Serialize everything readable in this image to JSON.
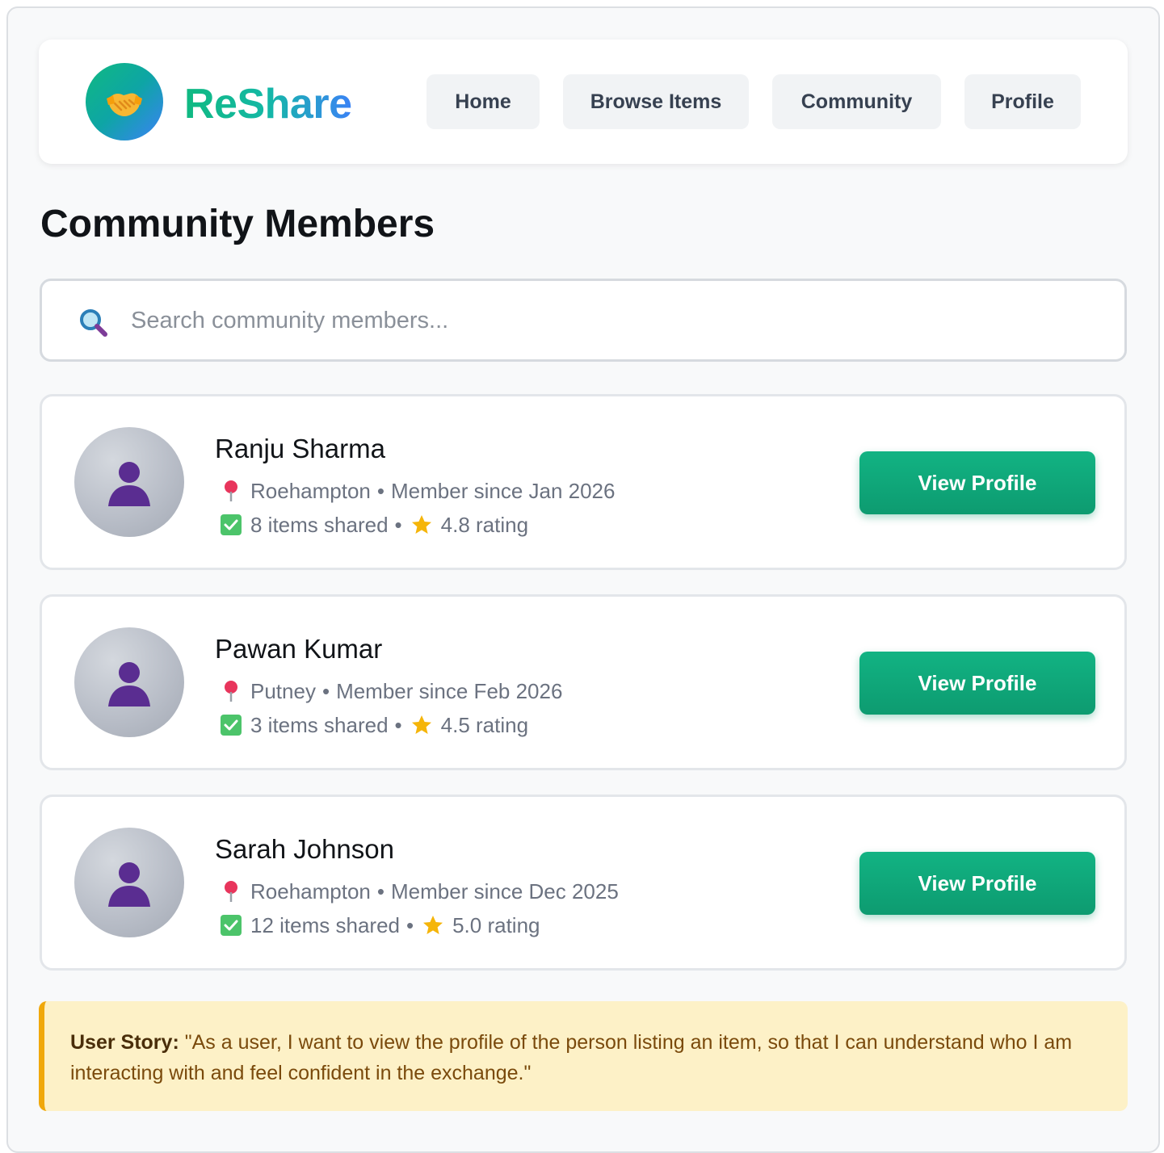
{
  "app": {
    "name": "ReShare"
  },
  "nav": {
    "items": [
      {
        "label": "Home"
      },
      {
        "label": "Browse Items"
      },
      {
        "label": "Community"
      },
      {
        "label": "Profile"
      }
    ]
  },
  "page": {
    "title": "Community Members"
  },
  "search": {
    "placeholder": "Search community members..."
  },
  "members": [
    {
      "name": "Ranju Sharma",
      "location": "Roehampton",
      "since": "Member since Jan 2026",
      "shared": "8 items shared",
      "rating": "4.8 rating",
      "button": "View Profile"
    },
    {
      "name": "Pawan Kumar",
      "location": "Putney",
      "since": "Member since Feb 2026",
      "shared": "3 items shared",
      "rating": "4.5 rating",
      "button": "View Profile"
    },
    {
      "name": "Sarah Johnson",
      "location": "Roehampton",
      "since": "Member since Dec 2025",
      "shared": "12 items shared",
      "rating": "5.0 rating",
      "button": "View Profile"
    }
  ],
  "story": {
    "label": "User Story:",
    "text": "\"As a user, I want to view the profile of the person listing an item, so that I can understand who I am interacting with and feel confident in the exchange.\""
  },
  "colors": {
    "accent": "#10b981",
    "brand_gradient_end": "#3b82f6",
    "story_bg": "#fdf1c7",
    "story_border": "#f0a80b"
  }
}
